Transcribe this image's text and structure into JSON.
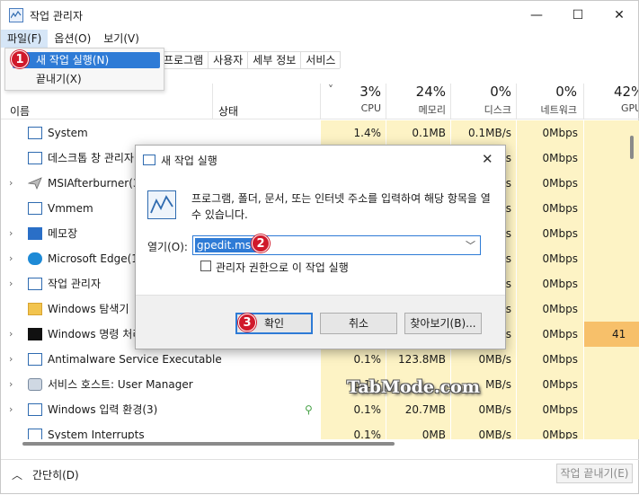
{
  "window": {
    "title": "작업 관리자",
    "minimize_glyph": "—",
    "maximize_glyph": "☐",
    "close_glyph": "✕"
  },
  "menubar": {
    "file": "파일(F)",
    "options": "옵션(O)",
    "view": "보기(V)"
  },
  "file_menu": {
    "run_new_task": "새 작업 실행(N)",
    "exit": "끝내기(X)"
  },
  "tabs": [
    "프로그램",
    "사용자",
    "세부 정보",
    "서비스"
  ],
  "columns": {
    "name": "이름",
    "status": "상태",
    "cpu": {
      "pct": "3%",
      "label": "CPU"
    },
    "memory": {
      "pct": "24%",
      "label": "메모리"
    },
    "disk": {
      "pct": "0%",
      "label": "디스크"
    },
    "network": {
      "pct": "0%",
      "label": "네트워크"
    },
    "gpu": {
      "pct": "42%",
      "label": "GPU"
    },
    "sort_glyph": "˅"
  },
  "processes": [
    {
      "name": "System",
      "cpu": "1.4%",
      "memory": "0.1MB",
      "disk": "0.1MB/s",
      "network": "0Mbps",
      "gpu": ""
    },
    {
      "name": "데스크톱 창 관리자",
      "cpu": "",
      "memory": "",
      "disk": "/s",
      "network": "0Mbps",
      "gpu": ""
    },
    {
      "name": "MSIAfterburner(32",
      "cpu": "",
      "memory": "",
      "disk": "/s",
      "network": "0Mbps",
      "gpu": ""
    },
    {
      "name": "Vmmem",
      "cpu": "",
      "memory": "",
      "disk": "/s",
      "network": "0Mbps",
      "gpu": ""
    },
    {
      "name": "메모장",
      "cpu": "",
      "memory": "",
      "disk": "/s",
      "network": "0Mbps",
      "gpu": ""
    },
    {
      "name": "Microsoft Edge(16",
      "cpu": "",
      "memory": "",
      "disk": "/s",
      "network": "0Mbps",
      "gpu": ""
    },
    {
      "name": "작업 관리자",
      "cpu": "",
      "memory": "",
      "disk": "/s",
      "network": "0Mbps",
      "gpu": ""
    },
    {
      "name": "Windows 탐색기",
      "cpu": "",
      "memory": "",
      "disk": "/s",
      "network": "0Mbps",
      "gpu": ""
    },
    {
      "name": "Windows 명령 처리",
      "cpu": "",
      "memory": "",
      "disk": "/s",
      "network": "0Mbps",
      "gpu": "41"
    },
    {
      "name": "Antimalware Service Executable",
      "cpu": "0.1%",
      "memory": "123.8MB",
      "disk": "0MB/s",
      "network": "0Mbps",
      "gpu": ""
    },
    {
      "name": "서비스 호스트: User Manager",
      "cpu": "0.1%",
      "memory": "",
      "disk": "MB/s",
      "network": "0Mbps",
      "gpu": ""
    },
    {
      "name": "Windows 입력 환경(3)",
      "cpu": "0.1%",
      "memory": "20.7MB",
      "disk": "0MB/s",
      "network": "0Mbps",
      "gpu": ""
    },
    {
      "name": "System Interrupts",
      "cpu": "0.1%",
      "memory": "0MB",
      "disk": "0MB/s",
      "network": "0Mbps",
      "gpu": ""
    }
  ],
  "footer": {
    "fewer_details": "간단히(D)",
    "end_task": "작업 끝내기(E)"
  },
  "run_dialog": {
    "title": "새 작업 실행",
    "close_glyph": "✕",
    "description": "프로그램, 폴더, 문서, 또는 인터넷 주소를 입력하여 해당 항목을 열 수 있습니다.",
    "open_label": "열기(O):",
    "open_value": "gpedit.msc",
    "admin_checkbox": "관리자 권한으로 이 작업 실행",
    "ok": "확인",
    "cancel": "취소",
    "browse": "찾아보기(B)..."
  },
  "badges": [
    "1",
    "2",
    "3"
  ],
  "watermark": "TabMode.com",
  "colors": {
    "accent": "#2e7bd6",
    "badge": "#d0192b",
    "cpu_highlight": "#fdf3c5",
    "gpu_highlight": "#f7c06a"
  },
  "icons": {
    "app": "task-manager-icon",
    "dialog": "task-manager-icon",
    "rows": [
      "system-icon",
      "window-icon",
      "plane-icon",
      "window-icon",
      "notepad-icon",
      "edge-icon",
      "task-manager-icon",
      "folder-icon",
      "cmd-icon",
      "window-icon",
      "gear-icon",
      "window-icon",
      "window-icon"
    ]
  }
}
